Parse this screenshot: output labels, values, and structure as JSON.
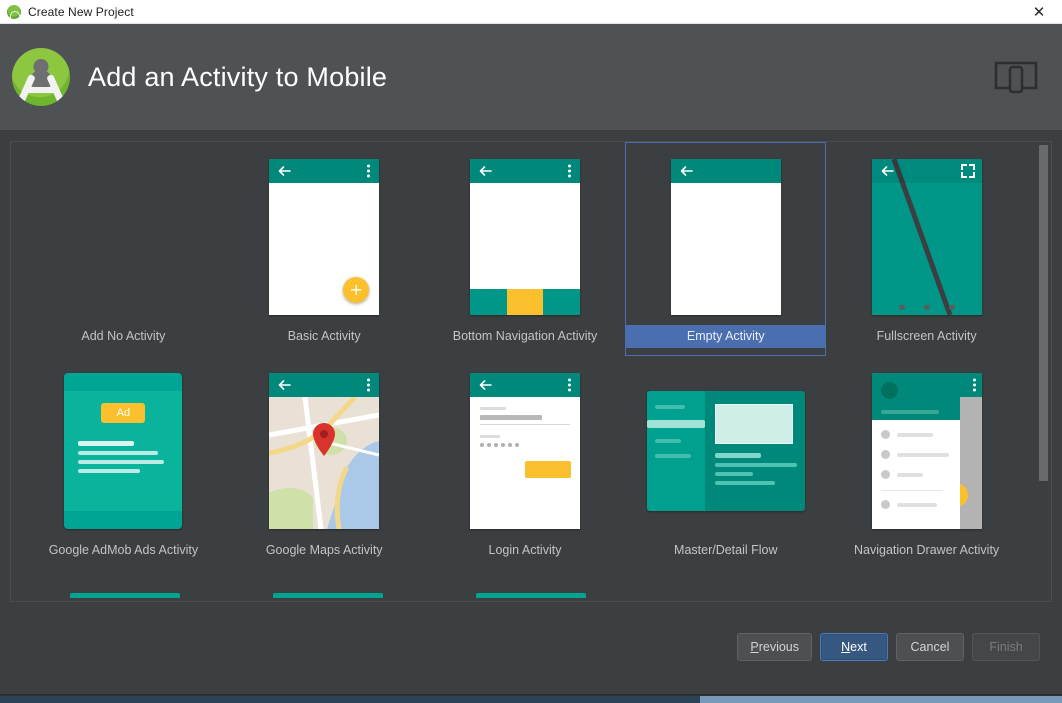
{
  "window": {
    "title": "Create New Project",
    "title_icon": "android-studio-icon",
    "close_label": "✕"
  },
  "header": {
    "title": "Add an Activity to Mobile",
    "logo_icon": "android-studio-logo",
    "device_icon": "mobile-device-icon"
  },
  "gallery": {
    "templates": [
      {
        "id": "add-no-activity",
        "label": "Add No Activity",
        "selected": false,
        "thumb": "none"
      },
      {
        "id": "basic-activity",
        "label": "Basic Activity",
        "selected": false,
        "thumb": "basic"
      },
      {
        "id": "bottom-navigation",
        "label": "Bottom Navigation Activity",
        "selected": false,
        "thumb": "bottomnav"
      },
      {
        "id": "empty-activity",
        "label": "Empty Activity",
        "selected": true,
        "thumb": "empty"
      },
      {
        "id": "fullscreen-activity",
        "label": "Fullscreen Activity",
        "selected": false,
        "thumb": "fullscreen"
      },
      {
        "id": "google-admob-ads",
        "label": "Google AdMob Ads Activity",
        "selected": false,
        "thumb": "admob"
      },
      {
        "id": "google-maps",
        "label": "Google Maps Activity",
        "selected": false,
        "thumb": "maps"
      },
      {
        "id": "login-activity",
        "label": "Login Activity",
        "selected": false,
        "thumb": "login"
      },
      {
        "id": "master-detail-flow",
        "label": "Master/Detail Flow",
        "selected": false,
        "thumb": "masterdetail"
      },
      {
        "id": "navigation-drawer",
        "label": "Navigation Drawer Activity",
        "selected": false,
        "thumb": "navdrawer"
      }
    ],
    "admob_badge": "Ad"
  },
  "footer": {
    "previous_label": "Previous",
    "previous_mnemonic": "P",
    "next_label": "Next",
    "next_mnemonic": "N",
    "cancel_label": "Cancel",
    "finish_label": "Finish",
    "finish_enabled": false
  },
  "colors": {
    "teal": "#00897b",
    "teal_bright": "#009688",
    "amber": "#fbc02d",
    "selection_blue": "#4b6eaf",
    "primary_button": "#365880",
    "dialog_bg": "#3c3f41",
    "header_bg": "#4e5254",
    "text": "#c3c3c3"
  }
}
